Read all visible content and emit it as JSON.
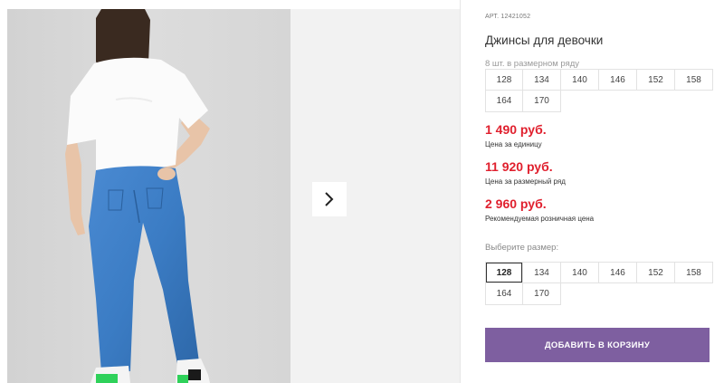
{
  "product": {
    "article": "АРТ. 12421052",
    "title": "Джинсы для девочки",
    "size_range_note": "8 шт. в размерном ряду",
    "range_sizes": [
      "128",
      "134",
      "140",
      "146",
      "152",
      "158",
      "164",
      "170"
    ],
    "prices": [
      {
        "value": "1 490 руб.",
        "note": "Цена за единицу"
      },
      {
        "value": "11 920 руб.",
        "note": "Цена за размерный ряд"
      },
      {
        "value": "2 960 руб.",
        "note": "Рекомендуемая розничная цена"
      }
    ],
    "choose_size_label": "Выберите размер:",
    "choose_sizes": [
      "128",
      "134",
      "140",
      "146",
      "152",
      "158",
      "164",
      "170"
    ],
    "selected_size": "128",
    "add_to_cart": "ДОБАВИТЬ В КОРЗИНУ"
  },
  "colors": {
    "price": "#e0202e",
    "button": "#7e5fa0",
    "jeans": "#3b7cc4",
    "shoe_accent": "#2fd15a"
  },
  "icons": {
    "next": "chevron-right-icon"
  }
}
